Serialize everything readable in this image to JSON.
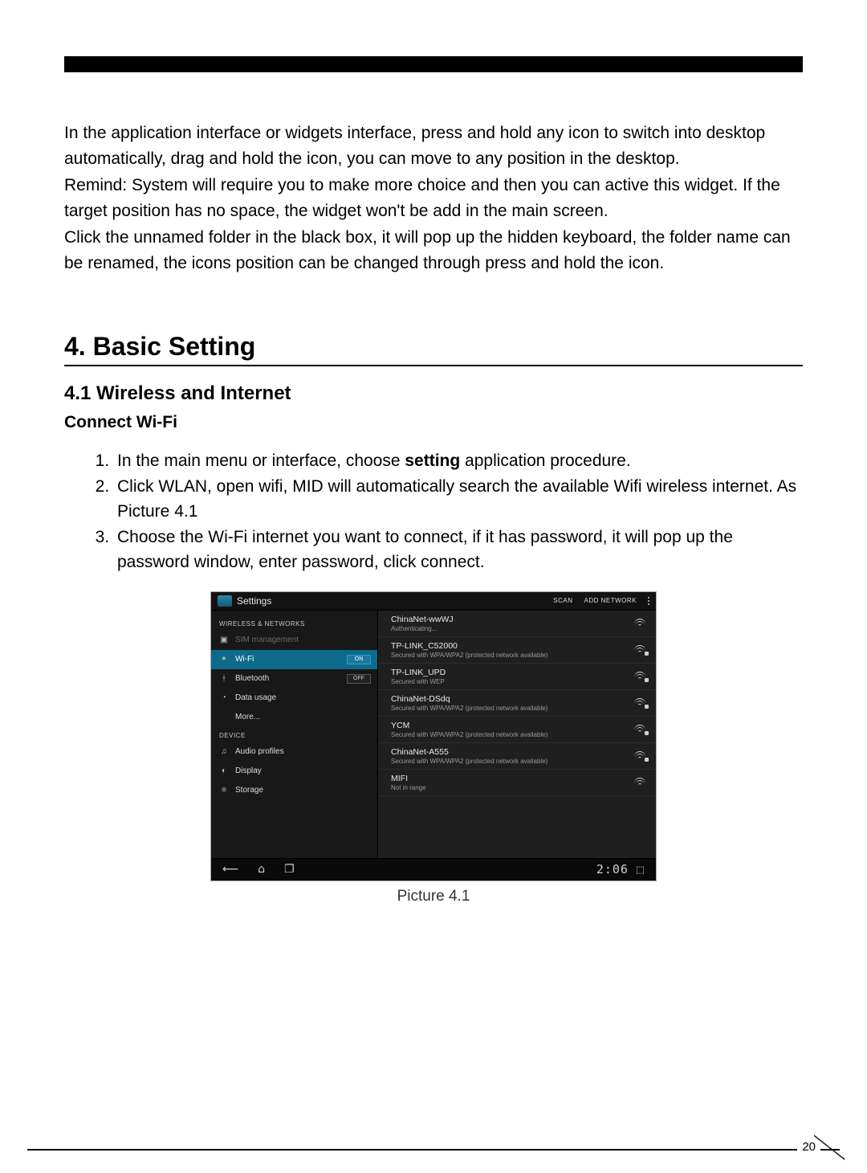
{
  "intro": {
    "p1": "In the application interface or widgets interface, press and hold any icon to switch into desktop automatically, drag and hold the icon, you can move to any position in the desktop.",
    "p2": "Remind: System will require you to make more choice and then you can active this widget. If the target position has no space, the widget won't be add in the main screen.",
    "p3": "Click the unnamed folder in the black box, it will pop up the hidden keyboard, the folder name can be renamed, the icons position can be changed through press and hold the icon."
  },
  "section": {
    "heading": "4. Basic Setting",
    "subheading": "4.1 Wireless and Internet",
    "subsub": "Connect Wi-Fi",
    "steps": {
      "s1a": "In the main menu or interface, choose ",
      "s1b": "setting",
      "s1c": " application procedure.",
      "s2": "Click WLAN, open wifi, MID will automatically search the available Wifi wireless internet. As Picture 4.1",
      "s3": "Choose the Wi-Fi internet you want to connect, if it has password, it will pop up the password window, enter password, click connect."
    }
  },
  "screenshot": {
    "title": "Settings",
    "scan": "SCAN",
    "add_network": "ADD NETWORK",
    "sidebar": {
      "cat1": "WIRELESS & NETWORKS",
      "sim": "SIM management",
      "wifi": "Wi-Fi",
      "wifi_toggle": "ON",
      "bt": "Bluetooth",
      "bt_toggle": "OFF",
      "data": "Data usage",
      "more": "More...",
      "cat2": "DEVICE",
      "audio": "Audio profiles",
      "display": "Display",
      "storage": "Storage"
    },
    "networks": [
      {
        "name": "ChinaNet-wwWJ",
        "sub": "Authenticating...",
        "locked": false
      },
      {
        "name": "TP-LINK_C52000",
        "sub": "Secured with WPA/WPA2 (protected network available)",
        "locked": true
      },
      {
        "name": "TP-LINK_UPD",
        "sub": "Secured with WEP",
        "locked": true
      },
      {
        "name": "ChinaNet-DSdq",
        "sub": "Secured with WPA/WPA2 (protected network available)",
        "locked": true
      },
      {
        "name": "YCM",
        "sub": "Secured with WPA/WPA2 (protected network available)",
        "locked": true
      },
      {
        "name": "ChinaNet-A555",
        "sub": "Secured with WPA/WPA2 (protected network available)",
        "locked": true
      },
      {
        "name": "MIFI",
        "sub": "Not in range",
        "locked": false
      }
    ],
    "clock": "2:06",
    "caption": "Picture 4.1"
  },
  "page_number": "20"
}
